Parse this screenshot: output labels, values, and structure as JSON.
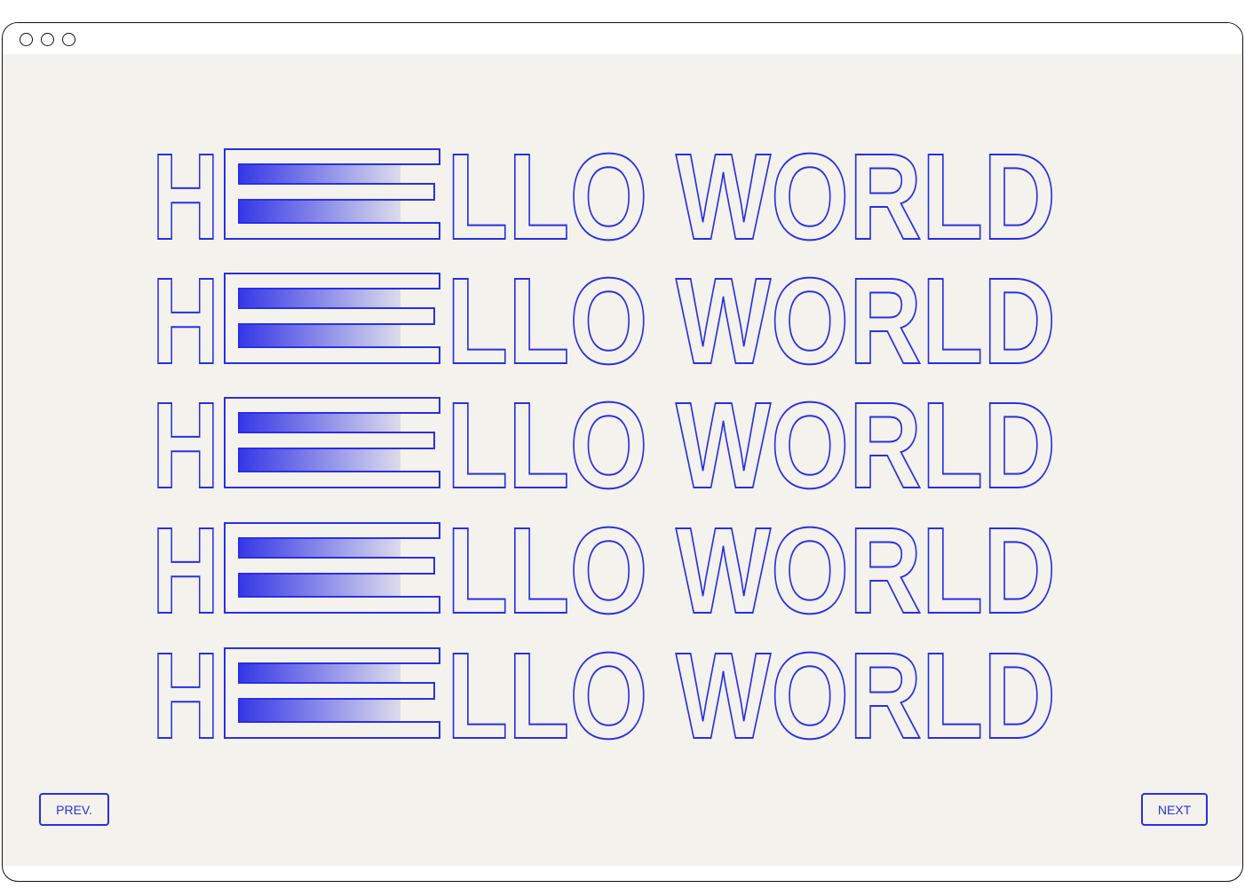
{
  "window": {
    "controls": [
      "window-dot",
      "window-dot",
      "window-dot"
    ]
  },
  "hero": {
    "lines": [
      "HELLO WORLD",
      "HELLO WORLD",
      "HELLO WORLD",
      "HELLO WORLD",
      "HELLO WORLD"
    ],
    "accent_color": "#2b2ee6",
    "background_color": "#f3f2ec"
  },
  "navigation": {
    "prev_label": "PREV.",
    "next_label": "NEXT"
  }
}
